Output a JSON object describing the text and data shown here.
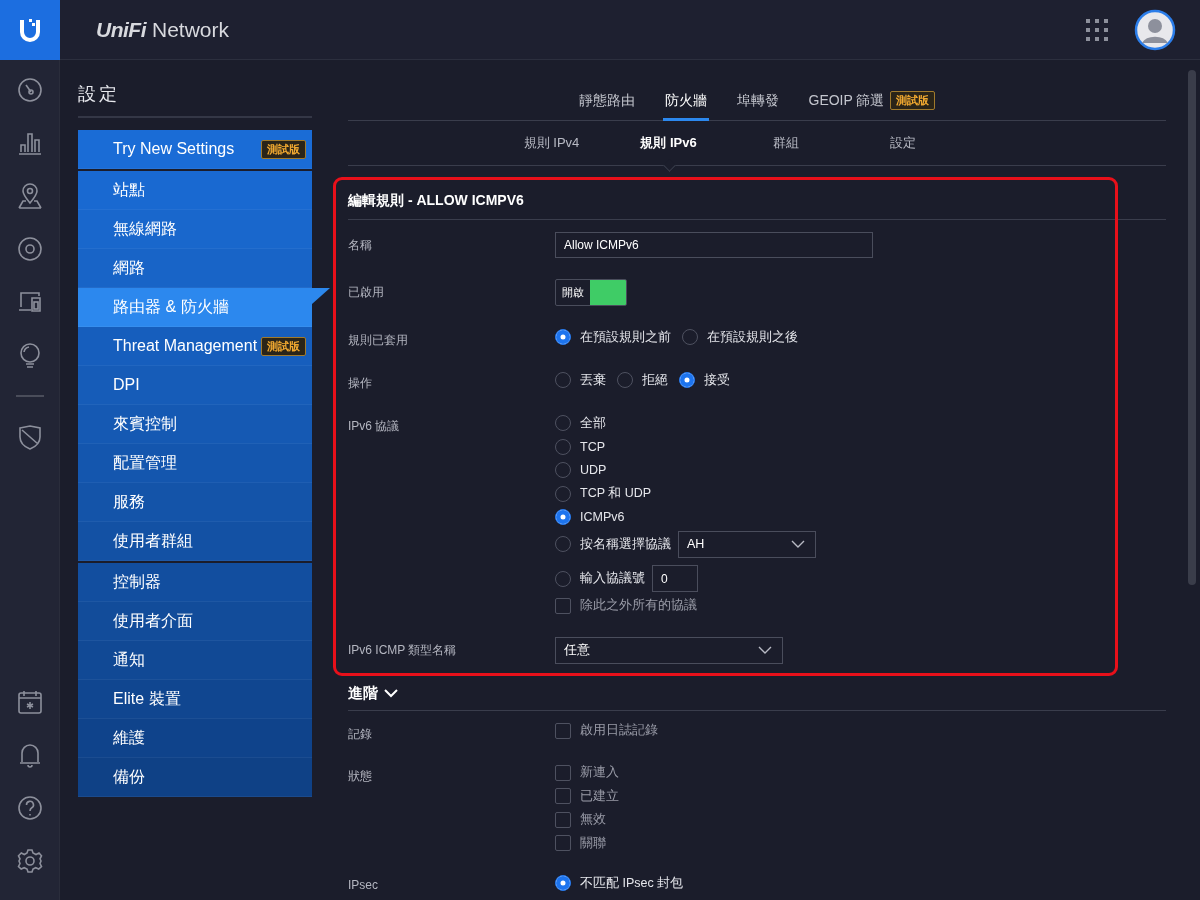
{
  "header": {
    "brand": "UniFi",
    "product": "Network"
  },
  "settings": {
    "title": "設定",
    "groups": [
      [
        {
          "label": "Try New Settings",
          "badge": "測試版",
          "selected": false
        }
      ],
      [
        {
          "label": "站點",
          "selected": false
        },
        {
          "label": "無線網路",
          "selected": false
        },
        {
          "label": "網路",
          "selected": false
        },
        {
          "label": "路由器 & 防火牆",
          "selected": true
        },
        {
          "label": "Threat Management",
          "badge": "測試版",
          "selected": false
        },
        {
          "label": "DPI",
          "selected": false
        },
        {
          "label": "來賓控制",
          "selected": false
        },
        {
          "label": "配置管理",
          "selected": false
        },
        {
          "label": "服務",
          "selected": false
        },
        {
          "label": "使用者群組",
          "selected": false
        }
      ],
      [
        {
          "label": "控制器",
          "selected": false
        },
        {
          "label": "使用者介面",
          "selected": false
        },
        {
          "label": "通知",
          "selected": false
        },
        {
          "label": "Elite 裝置",
          "selected": false
        },
        {
          "label": "維護",
          "selected": false
        },
        {
          "label": "備份",
          "selected": false
        }
      ]
    ]
  },
  "tabs": [
    {
      "label": "靜態路由",
      "selected": false
    },
    {
      "label": "防火牆",
      "selected": true
    },
    {
      "label": "埠轉發",
      "selected": false
    },
    {
      "label": "GEOIP 篩選",
      "badge": "測試版",
      "selected": false
    }
  ],
  "subtabs": [
    {
      "label": "規則 IPv4",
      "selected": false
    },
    {
      "label": "規則 IPv6",
      "selected": true
    },
    {
      "label": "群組",
      "selected": false
    },
    {
      "label": "設定",
      "selected": false
    }
  ],
  "form": {
    "title": "編輯規則 - ALLOW ICMPV6",
    "rows": [
      {
        "label": "名稱",
        "kind": "text",
        "value": "Allow ICMPv6"
      },
      {
        "label": "已啟用",
        "kind": "toggle",
        "text": "開啟",
        "on": true
      },
      {
        "label": "規則已套用",
        "kind": "radios",
        "options": [
          {
            "label": "在預設規則之前",
            "selected": true
          },
          {
            "label": "在預設規則之後",
            "selected": false
          }
        ]
      },
      {
        "label": "操作",
        "kind": "radios",
        "options": [
          {
            "label": "丟棄",
            "selected": false
          },
          {
            "label": "拒絕",
            "selected": false
          },
          {
            "label": "接受",
            "selected": true
          }
        ]
      },
      {
        "label": "IPv6 協議",
        "kind": "stack",
        "items": [
          {
            "kind": "radio",
            "label": "全部",
            "selected": false
          },
          {
            "kind": "radio",
            "label": "TCP",
            "selected": false
          },
          {
            "kind": "radio",
            "label": "UDP",
            "selected": false
          },
          {
            "kind": "radio",
            "label": "TCP 和 UDP",
            "selected": false
          },
          {
            "kind": "radio",
            "label": "ICMPv6",
            "selected": true
          },
          {
            "kind": "radio-select",
            "label": "按名稱選擇協議",
            "value": "AH",
            "selected": false
          },
          {
            "kind": "radio-input",
            "label": "輸入協議號",
            "value": "0",
            "selected": false
          },
          {
            "kind": "checkbox",
            "label": "除此之外所有的協議",
            "checked": false
          }
        ]
      },
      {
        "label": "IPv6 ICMP 類型名稱",
        "kind": "select",
        "value": "任意"
      }
    ]
  },
  "advanced": {
    "title": "進階",
    "expanded": true,
    "rows": [
      {
        "label": "記錄",
        "kind": "stack",
        "items": [
          {
            "kind": "checkbox",
            "label": "啟用日誌記錄",
            "checked": false
          }
        ]
      },
      {
        "label": "狀態",
        "kind": "stack",
        "items": [
          {
            "kind": "checkbox",
            "label": "新連入",
            "checked": false
          },
          {
            "kind": "checkbox",
            "label": "已建立",
            "checked": false
          },
          {
            "kind": "checkbox",
            "label": "無效",
            "checked": false
          },
          {
            "kind": "checkbox",
            "label": "關聯",
            "checked": false
          }
        ]
      },
      {
        "label": "IPsec",
        "kind": "stack",
        "items": [
          {
            "kind": "radio",
            "label": "不匹配 IPsec 封包",
            "selected": true
          }
        ]
      }
    ]
  }
}
